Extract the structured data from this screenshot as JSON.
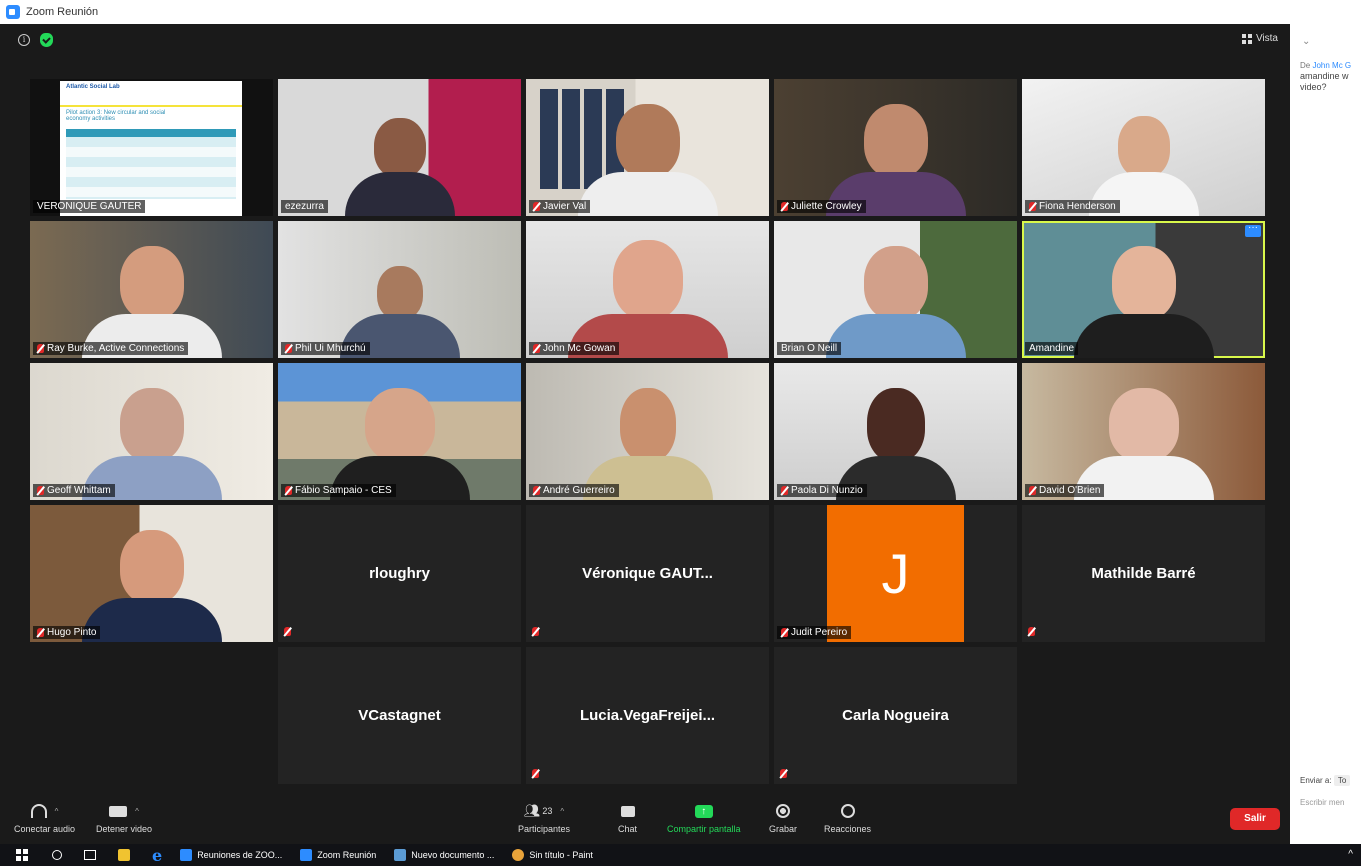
{
  "window": {
    "title": "Zoom Reunión"
  },
  "topbar": {
    "view_label": "Vista"
  },
  "tiles": [
    {
      "name": "VERONIQUE GAUTER",
      "slide_lines": [
        "Atlantic Social Lab",
        "Pilot action 3: New circular and social",
        "economy activities"
      ]
    },
    {
      "name": "ezezurra"
    },
    {
      "name": "Javier Val"
    },
    {
      "name": "Juliette Crowley"
    },
    {
      "name": "Fiona Henderson"
    },
    {
      "name": "Ray Burke, Active Connections"
    },
    {
      "name": "Phil Ui Mhurchú"
    },
    {
      "name": "John Mc Gowan"
    },
    {
      "name": "Brian O Neill"
    },
    {
      "name": "Amandine"
    },
    {
      "name": "Geoff Whittam"
    },
    {
      "name": "Fábio Sampaio - CES"
    },
    {
      "name": "André Guerreiro"
    },
    {
      "name": "Paola Di Nunzio"
    },
    {
      "name": "David O'Brien"
    },
    {
      "name": "Hugo Pinto"
    },
    {
      "name": "rloughry"
    },
    {
      "name": "Véronique  GAUT..."
    },
    {
      "name": "Judit Pereiro",
      "avatar_letter": "J"
    },
    {
      "name": "Mathilde Barré"
    },
    {
      "name": "VCastagnet"
    },
    {
      "name": "Lucia.VegaFreijei..."
    },
    {
      "name": "Carla Nogueira"
    }
  ],
  "toolbar": {
    "audio": "Conectar audio",
    "video": "Detener video",
    "participants": "Participantes",
    "participants_count": "23",
    "chat": "Chat",
    "share": "Compartir pantalla",
    "record": "Grabar",
    "reactions": "Reacciones",
    "leave": "Salir"
  },
  "chat_panel": {
    "from_prefix": "De",
    "from_name": "John Mc G",
    "message_line1": "amandine w",
    "message_line2": "video?",
    "send_to_label": "Enviar a:",
    "send_to_value": "To",
    "input_placeholder": "Escribir men"
  },
  "taskbar": {
    "items": [
      "Reuniones de ZOO...",
      "Zoom Reunión",
      "Nuevo documento ...",
      "Sin título - Paint"
    ]
  },
  "colors": {
    "accent": "#2d8cff",
    "leave": "#e02828",
    "share": "#23d959",
    "active_speaker": "#d9f84b",
    "avatar_orange": "#f26d00"
  }
}
